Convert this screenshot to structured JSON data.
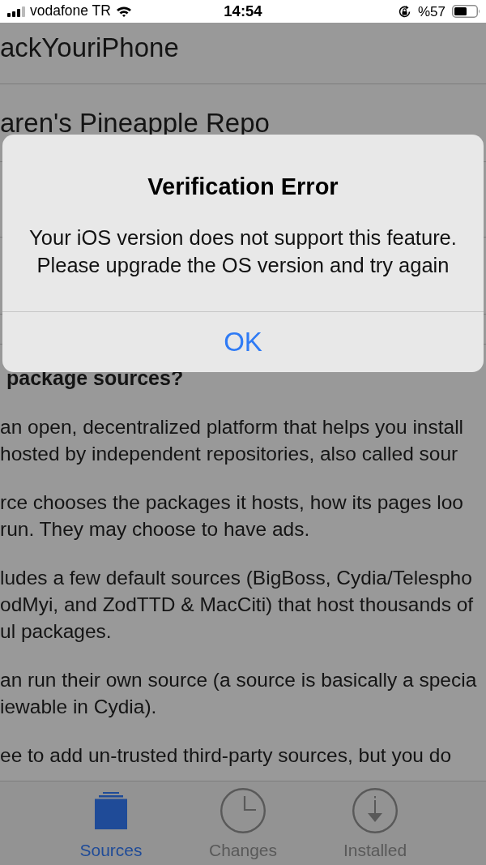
{
  "status_bar": {
    "carrier": "vodafone TR",
    "time": "14:54",
    "battery": "%57"
  },
  "source_list": [
    {
      "name": "ackYouriPhone"
    },
    {
      "name": "aren's Pineapple Repo"
    }
  ],
  "article": {
    "heading": "package sources?",
    "paragraphs": [
      [
        "an open, decentralized platform that helps you install",
        "hosted by independent repositories, also called sour"
      ],
      [
        "rce chooses the packages it hosts, how its pages loo",
        "run. They may choose to have ads."
      ],
      [
        "ludes a few default sources (BigBoss, Cydia/Telespho",
        "odMyi, and ZodTTD & MacCiti) that host thousands of",
        "ul packages."
      ],
      [
        "an run their own source (a source is basically a specia",
        "iewable in Cydia)."
      ],
      [
        "ee to add un-trusted third-party sources, but you do"
      ]
    ]
  },
  "alert": {
    "title": "Verification Error",
    "message": [
      "Your iOS version does not support this feature.",
      "Please upgrade the OS version and try again"
    ],
    "buttons": [
      "OK"
    ]
  },
  "tab_bar": [
    {
      "kind": "sources",
      "label": "Sources",
      "selected": true
    },
    {
      "kind": "changes",
      "label": "Changes",
      "selected": false
    },
    {
      "kind": "installed",
      "label": "Installed",
      "selected": false
    }
  ]
}
